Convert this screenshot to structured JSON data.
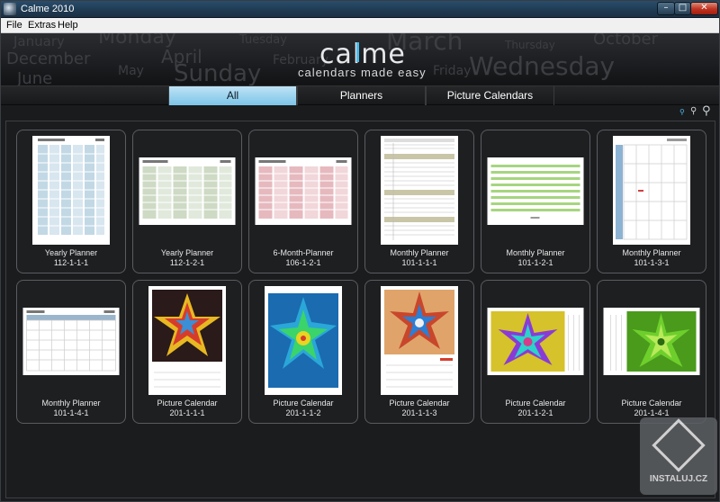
{
  "window": {
    "title": "Calme 2010",
    "min_icon": "minimize-icon",
    "max_icon": "maximize-icon",
    "close_icon": "close-icon"
  },
  "menu": {
    "file": "File",
    "extras": "Extras",
    "help": "Help"
  },
  "header": {
    "logo": "calme",
    "tagline": "calendars made easy",
    "bg_words": [
      "January",
      "Monday",
      "Tuesday",
      "March",
      "October",
      "December",
      "April",
      "February",
      "May",
      "Sunday",
      "Friday",
      "Thursday",
      "Wednesday",
      "June"
    ]
  },
  "tabs": {
    "all": "All",
    "planners": "Planners",
    "picture": "Picture Calendars"
  },
  "zoom_icons": [
    "zoom-small-icon",
    "zoom-medium-icon",
    "zoom-large-icon"
  ],
  "cards": [
    {
      "title": "Yearly Planner",
      "code": "112-1-1-1",
      "accent": "#8fb8d0"
    },
    {
      "title": "Yearly Planner",
      "code": "112-1-2-1",
      "accent": "#9db58a"
    },
    {
      "title": "6-Month-Planner",
      "code": "106-1-2-1",
      "accent": "#d68a94"
    },
    {
      "title": "Monthly Planner",
      "code": "101-1-1-1",
      "accent": "#c9c6a8"
    },
    {
      "title": "Monthly Planner",
      "code": "101-1-2-1",
      "accent": "#a6d57f"
    },
    {
      "title": "Monthly Planner",
      "code": "101-1-3-1",
      "accent": "#8db3d4"
    },
    {
      "title": "Monthly Planner",
      "code": "101-1-4-1",
      "accent": "#9ab6cc"
    },
    {
      "title": "Picture Calendar",
      "code": "201-1-1-1",
      "accent": "#d63c2c"
    },
    {
      "title": "Picture Calendar",
      "code": "201-1-1-2",
      "accent": "#2aa7d8"
    },
    {
      "title": "Picture Calendar",
      "code": "201-1-1-3",
      "accent": "#c8462c"
    },
    {
      "title": "Picture Calendar",
      "code": "201-1-2-1",
      "accent": "#8a3bd6"
    },
    {
      "title": "Picture Calendar",
      "code": "201-1-4-1",
      "accent": "#6ecf2c"
    }
  ],
  "watermark": {
    "text": "INSTALUJ.CZ"
  }
}
